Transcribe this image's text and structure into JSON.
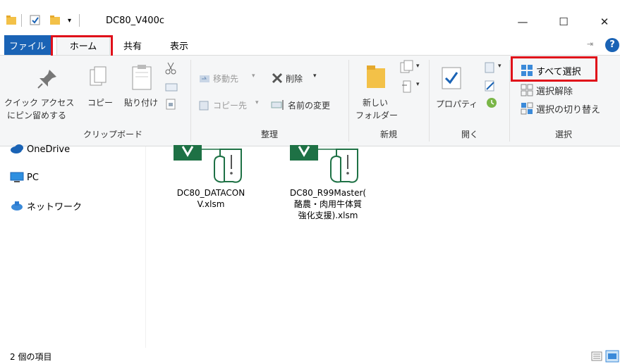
{
  "window": {
    "title": "DC80_V400c",
    "minimize": "—",
    "maximize": "☐",
    "close": "✕"
  },
  "tabs": {
    "file": "ファイル",
    "home": "ホーム",
    "share": "共有",
    "view": "表示"
  },
  "ribbon": {
    "clipboard": {
      "pin_label_1": "クイック アクセス",
      "pin_label_2": "にピン留めする",
      "copy": "コピー",
      "paste": "貼り付け",
      "group": "クリップボード"
    },
    "organize": {
      "move_to": "移動先",
      "copy_to": "コピー先",
      "delete": "削除",
      "rename": "名前の変更",
      "group": "整理"
    },
    "new": {
      "new_folder_1": "新しい",
      "new_folder_2": "フォルダー",
      "group": "新規"
    },
    "open": {
      "properties": "プロパティ",
      "group": "開く"
    },
    "select": {
      "select_all": "すべて選択",
      "select_none": "選択解除",
      "invert": "選択の切り替え",
      "group": "選択"
    }
  },
  "nav": {
    "onedrive": "OneDrive",
    "pc": "PC",
    "network": "ネットワーク"
  },
  "files": [
    {
      "line1": "DC80_DATACON",
      "line2": "V.xlsm",
      "line3": ""
    },
    {
      "line1": "DC80_R99Master(",
      "line2": "酪農・肉用牛体質",
      "line3": "強化支援).xlsm"
    }
  ],
  "status": {
    "count": "2 個の項目"
  },
  "colors": {
    "accent": "#1a63b5",
    "highlight": "#e0101a",
    "excel_green": "#1e7145"
  }
}
